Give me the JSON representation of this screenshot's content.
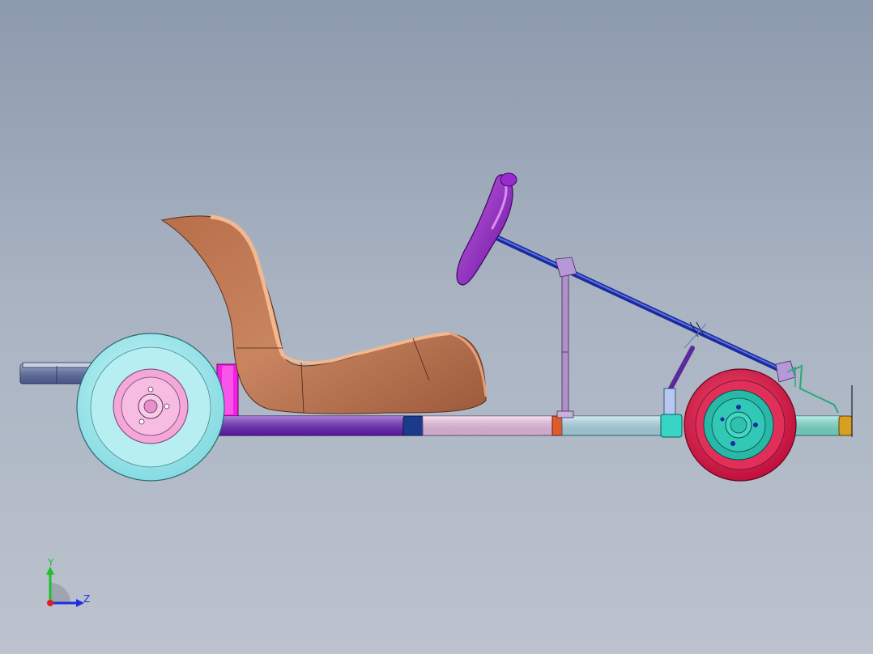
{
  "triad": {
    "y_label": "Y",
    "z_label": "Z",
    "y_color": "#1fbf2a",
    "z_color": "#1d2ee0",
    "x_color": "#e02020"
  },
  "colors": {
    "background_top": "#8c9aad",
    "background_bottom": "#bcc3ce",
    "seat": "#c9825c",
    "steering_wheel": "#8a1fbf",
    "steering_column": "#2a3fbf",
    "rear_tire": "#a8ecf0",
    "rear_hub": "#f2a8d8",
    "front_tire": "#d81e4e",
    "front_hub": "#2ab8a8",
    "frame_rear": "#6a1fc0",
    "frame_mid": "#f6c8ee",
    "frame_front": "#b4e2f2",
    "front_bumper": "#7ee8d6"
  }
}
